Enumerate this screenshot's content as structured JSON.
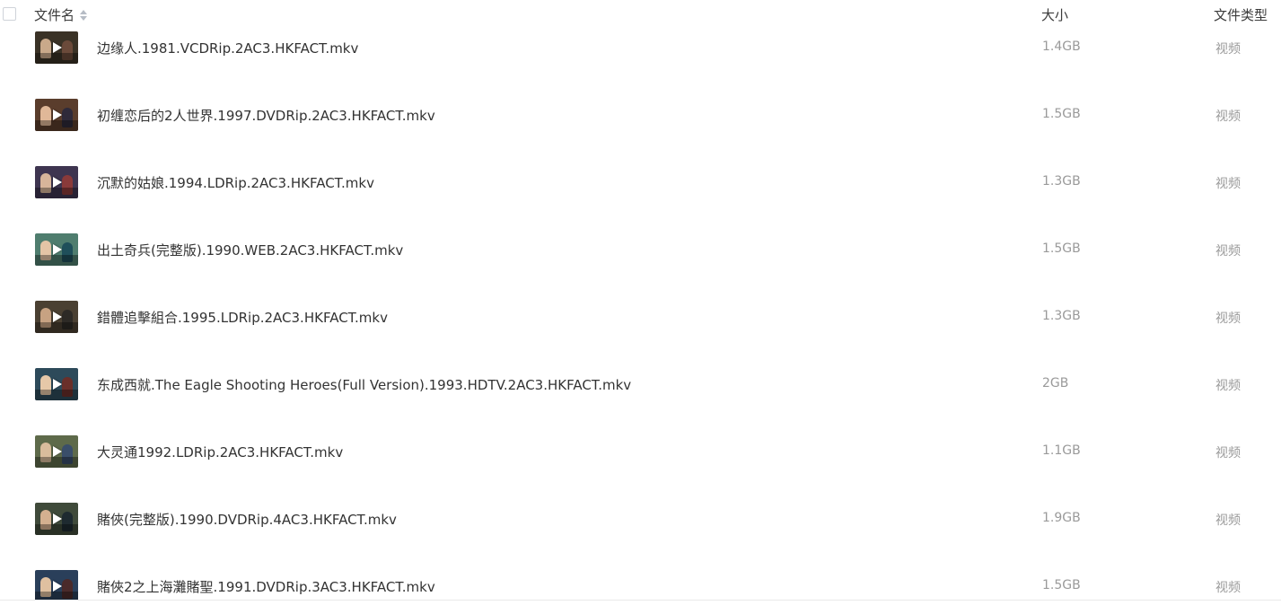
{
  "header": {
    "name_label": "文件名",
    "size_label": "大小",
    "type_label": "文件类型"
  },
  "files": [
    {
      "name": "边缘人.1981.VCDRip.2AC3.HKFACT.mkv",
      "size": "1.4GB",
      "type": "视频",
      "thumb": {
        "bg": "#3a3226",
        "fig1": "#c9a98a",
        "fig2": "#6b4a3a"
      }
    },
    {
      "name": "初缠恋后的2人世界.1997.DVDRip.2AC3.HKFACT.mkv",
      "size": "1.5GB",
      "type": "视频",
      "thumb": {
        "bg": "#5a3d2c",
        "fig1": "#e0b898",
        "fig2": "#2f2a3a"
      }
    },
    {
      "name": "沉默的姑娘.1994.LDRip.2AC3.HKFACT.mkv",
      "size": "1.3GB",
      "type": "视频",
      "thumb": {
        "bg": "#3e3550",
        "fig1": "#d7b59a",
        "fig2": "#8a3a3a"
      }
    },
    {
      "name": "出土奇兵(完整版).1990.WEB.2AC3.HKFACT.mkv",
      "size": "1.5GB",
      "type": "视频",
      "thumb": {
        "bg": "#4f7d6e",
        "fig1": "#e4c4a6",
        "fig2": "#1f4f5a"
      }
    },
    {
      "name": "錯體追擊組合.1995.LDRip.2AC3.HKFACT.mkv",
      "size": "1.3GB",
      "type": "视频",
      "thumb": {
        "bg": "#4a4032",
        "fig1": "#c7a282",
        "fig2": "#2d2a26"
      }
    },
    {
      "name": "东成西就.The Eagle Shooting Heroes(Full Version).1993.HDTV.2AC3.HKFACT.mkv",
      "size": "2GB",
      "type": "视频",
      "thumb": {
        "bg": "#2d4a5a",
        "fig1": "#e6c8a8",
        "fig2": "#6a2f2a"
      }
    },
    {
      "name": "大灵通1992.LDRip.2AC3.HKFACT.mkv",
      "size": "1.1GB",
      "type": "视频",
      "thumb": {
        "bg": "#5e6a4a",
        "fig1": "#d9bc9c",
        "fig2": "#3a4e6a"
      }
    },
    {
      "name": "賭俠(完整版).1990.DVDRip.4AC3.HKFACT.mkv",
      "size": "1.9GB",
      "type": "视频",
      "thumb": {
        "bg": "#3f4a3a",
        "fig1": "#d4b090",
        "fig2": "#1e2a30"
      }
    },
    {
      "name": "賭俠2之上海灘賭聖.1991.DVDRip.3AC3.HKFACT.mkv",
      "size": "1.5GB",
      "type": "视频",
      "thumb": {
        "bg": "#2a3f5a",
        "fig1": "#dfc0a0",
        "fig2": "#4a2a2a"
      }
    }
  ],
  "icons": {
    "play": "play-icon",
    "sort": "sort-icon",
    "checkbox": "checkbox"
  }
}
